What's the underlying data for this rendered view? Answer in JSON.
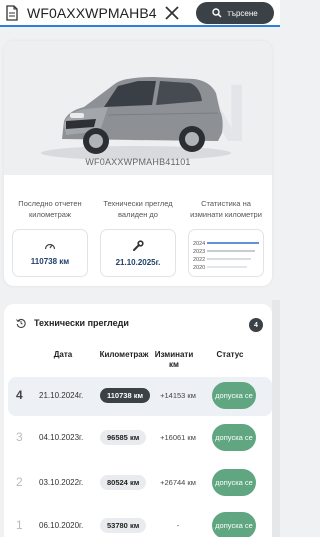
{
  "search": {
    "value": "WF0AXXWPMAHB41101",
    "button_label": "търсене"
  },
  "vehicle": {
    "watermark": "VIN",
    "vin": "WF0AXXWPMAHB41101"
  },
  "stats": {
    "last_km": {
      "label": "Последно отчетен километраж",
      "value": "110738 км"
    },
    "inspection": {
      "label": "Технически преглед валиден до",
      "value": "21.10.2025г."
    },
    "chart": {
      "label": "Статистика на изминати километри",
      "years": [
        "2024",
        "2023",
        "2022",
        "2020"
      ],
      "colors": [
        "#2f6fd0",
        "#8e98a3",
        "#b3bac1",
        "#c9ced3"
      ]
    }
  },
  "inspections": {
    "title": "Технически прегледи",
    "count": "4",
    "headers": {
      "date": "Дата",
      "km": "Километраж",
      "diff": "Изминати км",
      "status": "Статус"
    },
    "rows": [
      {
        "num": "4",
        "date": "21.10.2024г.",
        "km": "110738 км",
        "diff": "+14153 км",
        "status": "допуска се"
      },
      {
        "num": "3",
        "date": "04.10.2023г.",
        "km": "96585 км",
        "diff": "+16061 км",
        "status": "допуска се"
      },
      {
        "num": "2",
        "date": "03.10.2022г.",
        "km": "80524 км",
        "diff": "+26744 км",
        "status": "допуска се"
      },
      {
        "num": "1",
        "date": "06.10.2020г.",
        "km": "53780 км",
        "diff": "-",
        "status": "допуска се"
      }
    ]
  }
}
